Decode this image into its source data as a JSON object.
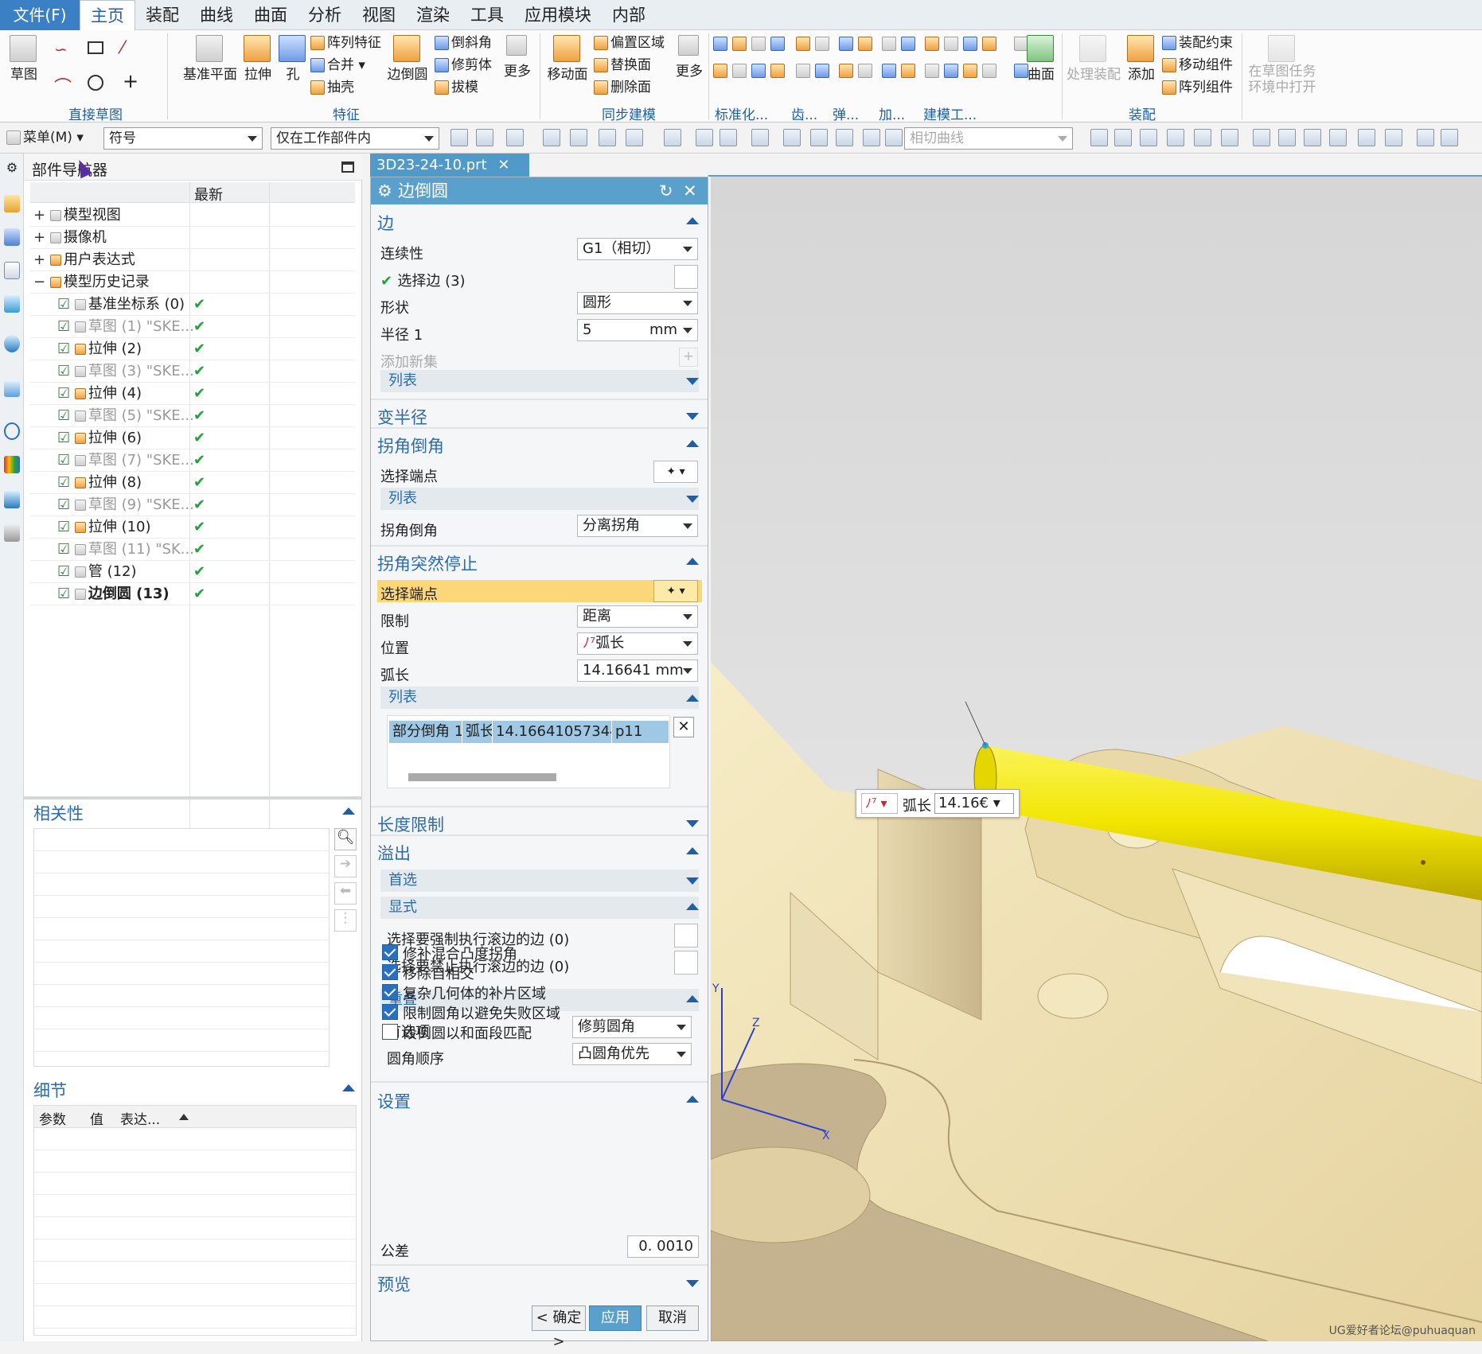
{
  "menu_bar": {
    "file": "文件(F)",
    "tabs": [
      "主页",
      "装配",
      "曲线",
      "曲面",
      "分析",
      "视图",
      "渲染",
      "工具",
      "应用模块",
      "内部"
    ],
    "active_tab": "主页"
  },
  "ribbon": {
    "sketch": "草图",
    "direct_sketch_group": "直接草图",
    "datum_plane": "基准平面",
    "extrude": "拉伸",
    "hole": "孔",
    "pattern_feature": "阵列特征",
    "unite": "合并",
    "shell": "抽壳",
    "edge_blend": "边倒圆",
    "chamfer": "倒斜角",
    "trim_body": "修剪体",
    "draft": "拔模",
    "more": "更多",
    "feature_group": "特征",
    "move_face": "移动面",
    "offset_region": "偏置区域",
    "replace_face": "替换面",
    "delete_face": "删除面",
    "more2": "更多",
    "sync_group": "同步建模",
    "standard_group": "标准化...",
    "gear_group": "齿...",
    "spring_group": "弹...",
    "add_group": "加...",
    "modeling_tools_group": "建模工...",
    "surface": "曲面",
    "process_assembly": "处理装配",
    "add": "添加",
    "assembly_constraints": "装配约束",
    "move_component": "移动组件",
    "pattern_component": "阵列组件",
    "assembly_group": "装配",
    "open_in_sketch_task": "在草图任务",
    "open_in_sketch_task2": "环境中打开"
  },
  "toolbar2": {
    "menu": "菜单(M)",
    "filter_value": "符号",
    "scope_value": "仅在工作部件内",
    "curve_rule": "相切曲线"
  },
  "navigator": {
    "title": "部件导航器",
    "col_latest": "最新",
    "rows": [
      {
        "label": "模型视图",
        "prefix": "+",
        "check": ""
      },
      {
        "label": "摄像机",
        "prefix": "+",
        "check": ""
      },
      {
        "label": "用户表达式",
        "prefix": "+",
        "check": ""
      },
      {
        "label": "模型历史记录",
        "prefix": "−",
        "check": ""
      },
      {
        "label": "基准坐标系 (0)",
        "prefix": "",
        "check": "✔"
      },
      {
        "label": "草图 (1) \"SKE...",
        "prefix": "",
        "check": "✔"
      },
      {
        "label": "拉伸 (2)",
        "prefix": "",
        "check": "✔"
      },
      {
        "label": "草图 (3) \"SKE...",
        "prefix": "",
        "check": "✔"
      },
      {
        "label": "拉伸 (4)",
        "prefix": "",
        "check": "✔"
      },
      {
        "label": "草图 (5) \"SKE...",
        "prefix": "",
        "check": "✔"
      },
      {
        "label": "拉伸 (6)",
        "prefix": "",
        "check": "✔"
      },
      {
        "label": "草图 (7) \"SKE...",
        "prefix": "",
        "check": "✔"
      },
      {
        "label": "拉伸 (8)",
        "prefix": "",
        "check": "✔"
      },
      {
        "label": "草图 (9) \"SKE...",
        "prefix": "",
        "check": "✔"
      },
      {
        "label": "拉伸 (10)",
        "prefix": "",
        "check": "✔"
      },
      {
        "label": "草图 (11) \"SK...",
        "prefix": "",
        "check": "✔"
      },
      {
        "label": "管 (12)",
        "prefix": "",
        "check": "✔"
      },
      {
        "label": "边倒圆 (13)",
        "prefix": "",
        "check": "✔"
      }
    ],
    "dependency_title": "相关性",
    "details_title": "细节",
    "details_cols": [
      "参数",
      "值",
      "表达..."
    ]
  },
  "doc_tab": {
    "label": "3D23-24-10.prt"
  },
  "dialog": {
    "title": "边倒圆",
    "edge_section": "边",
    "continuity_label": "连续性",
    "continuity_value": "G1（相切）",
    "select_edge": "选择边 (3)",
    "shape_label": "形状",
    "shape_value": "圆形",
    "radius_label": "半径 1",
    "radius_value": "5",
    "radius_unit": "mm",
    "add_new_set": "添加新集",
    "list_label": "列表",
    "variable_radius": "变半径",
    "corner_setback": "拐角倒角",
    "select_endpoint": "选择端点",
    "list_label2": "列表",
    "corner_setback_label": "拐角倒角",
    "corner_setback_value": "分离拐角",
    "stop_short": "拐角突然停止",
    "select_endpoint2": "选择端点",
    "limit_label": "限制",
    "limit_value": "距离",
    "position_label": "位置",
    "position_value": "弧长",
    "arc_length_label": "弧长",
    "arc_length_value": "14.16641 mm",
    "list_label3": "列表",
    "table_row": [
      "部分倒角 1",
      "弧长",
      "14.1664105734452",
      "p11"
    ],
    "length_limit": "长度限制",
    "overflow": "溢出",
    "preferred": "首选",
    "explicit": "显式",
    "force_roll": "选择要强制执行滚边的边 (0)",
    "prevent_roll": "选择要禁止执行滚边的边 (0)",
    "overlap": "重叠",
    "preference_label": "首选项",
    "preference_value": "修剪圆角",
    "blend_order_label": "圆角顺序",
    "blend_order_value": "凸圆角优先",
    "settings": "设置",
    "opt1": "修补混合凸度拐角",
    "opt2": "移除自相交",
    "opt3": "复杂几何体的补片区域",
    "opt4": "限制圆角以避免失败区域",
    "opt5": "段倒圆以和面段匹配",
    "opt_states": [
      true,
      true,
      true,
      true,
      false
    ],
    "tolerance_label": "公差",
    "tolerance_value": "0. 0010",
    "preview": "预览",
    "ok": "< 确定 >",
    "apply": "应用",
    "cancel": "取消"
  },
  "viewport": {
    "onscreen_label": "弧长",
    "onscreen_value": "14.16€",
    "watermark": "UG爱好者论坛@puhuaquan",
    "axis_labels": [
      "Y",
      "Z",
      "X"
    ]
  },
  "colors": {
    "accent": "#5aa0cd",
    "part": "#f3e6b8",
    "tube": "#f2e600",
    "file_menu": "#3b7fc4"
  }
}
